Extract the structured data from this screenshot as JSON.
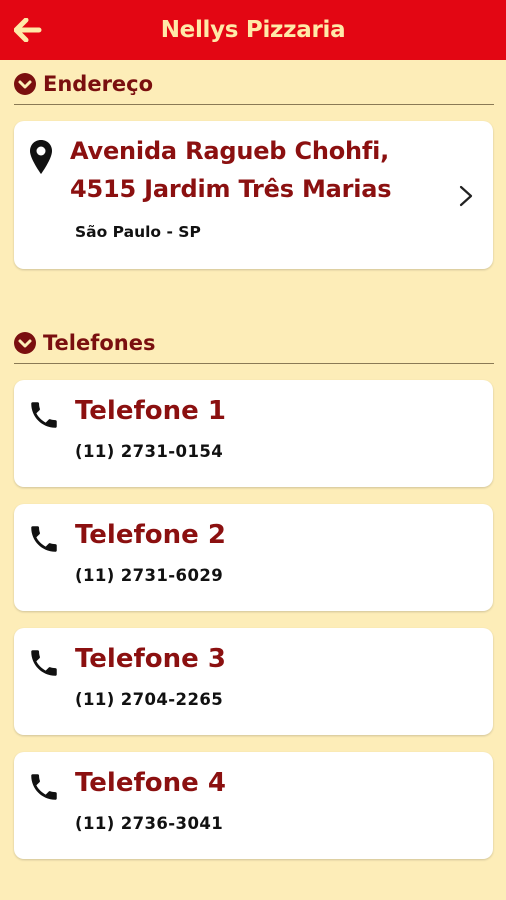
{
  "header": {
    "title": "Nellys Pizzaria",
    "back_icon": "arrow-left-icon"
  },
  "address_section": {
    "label": "Endereço",
    "icon": "chevron-down-circle-icon",
    "street_line1": "Avenida Ragueb Chohfi,",
    "street_line2": "4515 Jardim Três Marias",
    "city": "São Paulo - SP",
    "pin_icon": "map-pin-icon",
    "chevron_icon": "chevron-right-icon"
  },
  "phones_section": {
    "label": "Telefones",
    "icon": "chevron-down-circle-icon",
    "phone_icon": "phone-icon",
    "items": [
      {
        "title": "Telefone 1",
        "number": "(11) 2731-0154"
      },
      {
        "title": "Telefone 2",
        "number": "(11) 2731-6029"
      },
      {
        "title": "Telefone 3",
        "number": "(11) 2704-2265"
      },
      {
        "title": "Telefone 4",
        "number": "(11) 2736-3041"
      }
    ]
  },
  "colors": {
    "header_bg": "#e30613",
    "header_text": "#ffe9a8",
    "page_bg": "#fdedb8",
    "accent_text": "#8b1010"
  }
}
